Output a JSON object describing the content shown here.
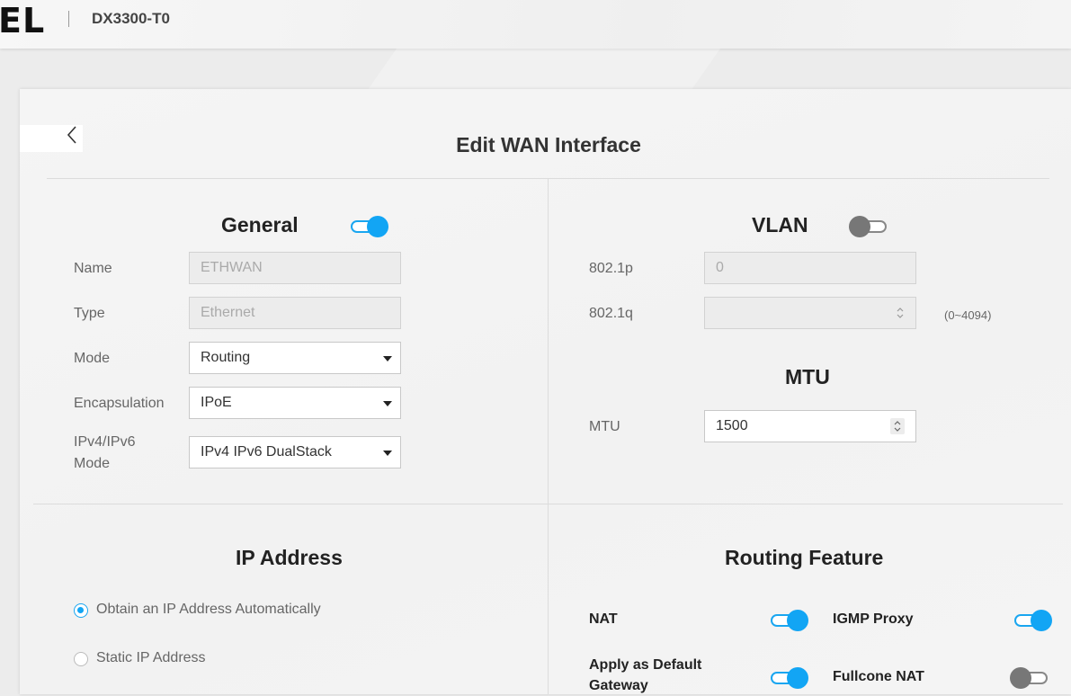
{
  "header": {
    "logo": "EL",
    "model": "DX3300-T0"
  },
  "page": {
    "title": "Edit WAN Interface"
  },
  "general": {
    "title": "General",
    "enabled": true,
    "name": {
      "label": "Name",
      "value": "ETHWAN"
    },
    "type": {
      "label": "Type",
      "value": "Ethernet"
    },
    "mode": {
      "label": "Mode",
      "value": "Routing"
    },
    "encapsulation": {
      "label": "Encapsulation",
      "value": "IPoE"
    },
    "ip_mode": {
      "label_line1": "IPv4/IPv6",
      "label_line2": "Mode",
      "value": "IPv4 IPv6 DualStack"
    }
  },
  "vlan": {
    "title": "VLAN",
    "enabled": false,
    "p": {
      "label": "802.1p",
      "value": "0"
    },
    "q": {
      "label": "802.1q",
      "value": "",
      "hint": "(0~4094)"
    }
  },
  "mtu": {
    "title": "MTU",
    "label": "MTU",
    "value": "1500"
  },
  "ip_address": {
    "title": "IP Address",
    "options": [
      {
        "label": "Obtain an IP Address Automatically",
        "checked": true
      },
      {
        "label": "Static IP Address",
        "checked": false
      }
    ]
  },
  "routing": {
    "title": "Routing Feature",
    "features": [
      {
        "label": "NAT",
        "enabled": true
      },
      {
        "label": "IGMP Proxy",
        "enabled": true
      },
      {
        "label_line1": "Apply as Default",
        "label_line2": "Gateway",
        "enabled": true
      },
      {
        "label": "Fullcone NAT",
        "enabled": false
      }
    ]
  },
  "colors": {
    "accent": "#12a5f4",
    "toggle_off": "#777777",
    "disabled_field": "#ececec"
  },
  "icons": {
    "back": "chevron-left-icon",
    "dropdown": "caret-down-icon",
    "spinner": "spinner-arrows-icon"
  }
}
